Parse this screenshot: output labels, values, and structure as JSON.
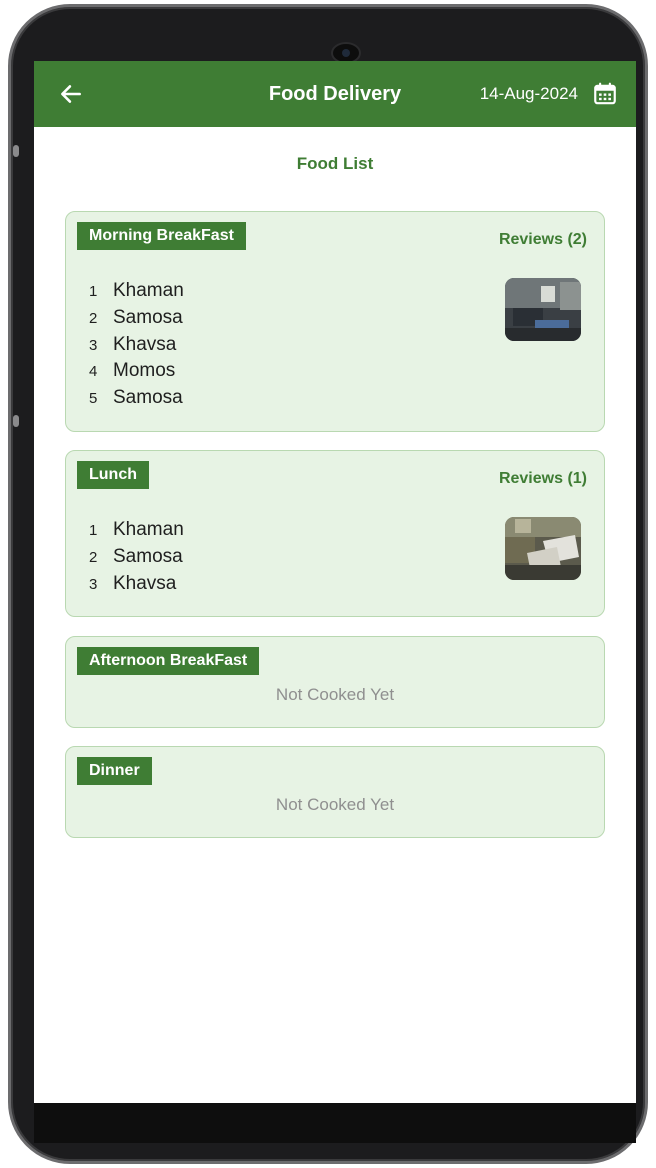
{
  "appbar": {
    "title": "Food Delivery",
    "date": "14-Aug-2024",
    "back_icon": "arrow-left-icon",
    "calendar_icon": "calendar-icon"
  },
  "section_title": "Food List",
  "colors": {
    "primary": "#3f7d34",
    "card_bg": "#e7f3e4",
    "card_border": "#b9d8b1",
    "muted_text": "#8f8f8f"
  },
  "meals": {
    "breakfast": {
      "label": "Morning BreakFast",
      "reviews": "Reviews (2)",
      "items": [
        {
          "num": "1",
          "name": "Khaman"
        },
        {
          "num": "2",
          "name": "Samosa"
        },
        {
          "num": "3",
          "name": "Khavsa"
        },
        {
          "num": "4",
          "name": "Momos"
        },
        {
          "num": "5",
          "name": "Samosa"
        }
      ]
    },
    "lunch": {
      "label": "Lunch",
      "reviews": "Reviews (1)",
      "items": [
        {
          "num": "1",
          "name": "Khaman"
        },
        {
          "num": "2",
          "name": "Samosa"
        },
        {
          "num": "3",
          "name": "Khavsa"
        }
      ]
    },
    "afternoon": {
      "label": "Afternoon BreakFast",
      "status": "Not Cooked Yet"
    },
    "dinner": {
      "label": "Dinner",
      "status": "Not Cooked Yet"
    }
  }
}
